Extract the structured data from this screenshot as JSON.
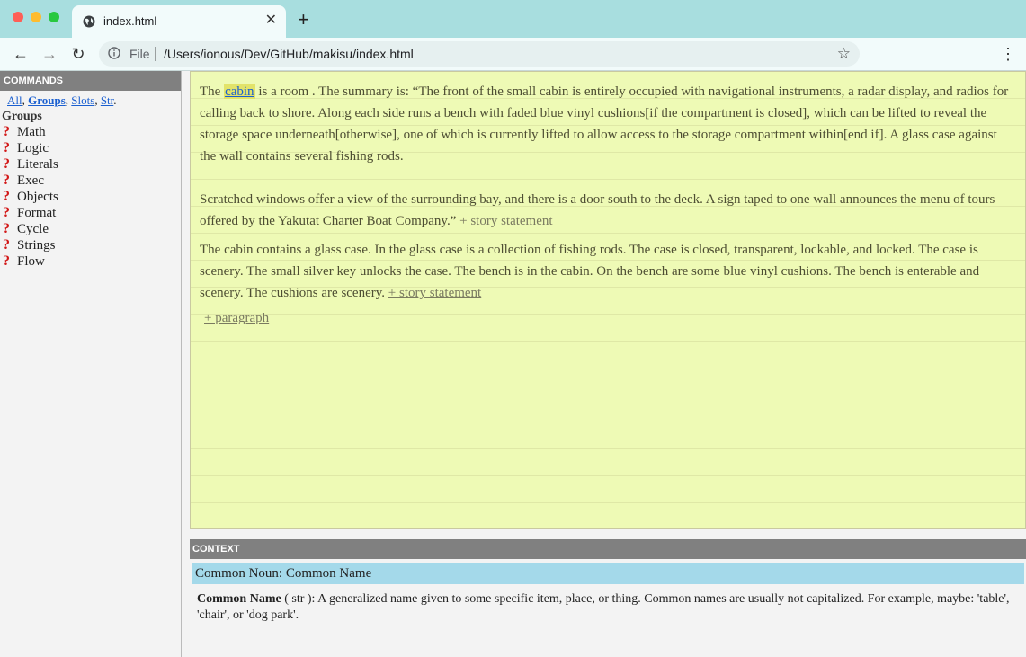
{
  "browser": {
    "tab_title": "index.html",
    "tab_close": "✕",
    "new_tab": "+",
    "file_label": "File",
    "url": "/Users/ionous/Dev/GitHub/makisu/index.html"
  },
  "commands": {
    "header": "COMMANDS",
    "links": [
      "All",
      "Groups",
      "Slots",
      "Str"
    ],
    "groups_title": "Groups",
    "groups": [
      "Math",
      "Logic",
      "Literals",
      "Exec",
      "Objects",
      "Format",
      "Cycle",
      "Strings",
      "Flow"
    ]
  },
  "story": {
    "p1_pre": "The ",
    "p1_noun": "cabin",
    "p1_text": " is a room . The summary is: “The front of the small cabin is entirely occupied with navigational instruments, a radar display, and radios for calling back to shore. Along each side runs a bench with faded blue vinyl cushions[if the compartment is closed], which can be lifted to reveal the storage space underneath[otherwise], one of which is currently lifted to allow access to the storage compartment within[end if]. A glass case against the wall contains several fishing rods.",
    "p2_text": "Scratched windows offer a view of the surrounding bay, and there is a door south to the deck. A sign taped to one wall announces the menu of tours offered by the Yakutat Charter Boat Company.” ",
    "p3_text": "The cabin contains a glass case. In the glass case is a collection of fishing rods. The case is closed, transparent, lockable, and locked. The case is scenery. The small silver key unlocks the case. The bench is in the cabin. On the bench are some blue vinyl cushions. The bench is enterable and scenery. The cushions are scenery.  ",
    "add_statement": " + story statement",
    "add_paragraph": " + paragraph"
  },
  "context": {
    "header": "CONTEXT",
    "title": "Common Noun: Common Name",
    "term": "Common Name",
    "type": " ( str ): ",
    "description": "A generalized name given to some specific item, place, or thing. Common names are usually not capitalized. For example, maybe: 'table', 'chair', or 'dog park'."
  },
  "colors": {
    "tabbar": "#a8dedf",
    "editor_bg": "#eefab5",
    "panel_header": "#808080",
    "context_highlight": "#a4d9ea",
    "link": "#1a5fd0",
    "question_mark": "#d21a1a"
  }
}
